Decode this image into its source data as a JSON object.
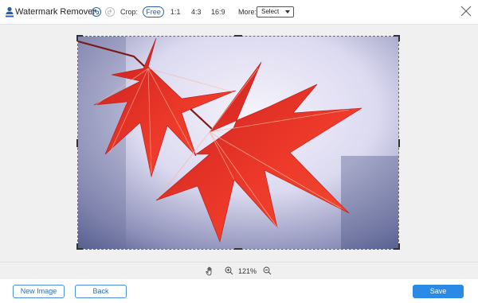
{
  "app": {
    "title": "Watermark Remover",
    "logo_icon": "person-upload-icon"
  },
  "toolbar": {
    "undo_icon": "undo-icon",
    "redo_icon": "redo-icon",
    "crop_label": "Crop:",
    "crop_options": [
      "Free",
      "1:1",
      "4:3",
      "16:9"
    ],
    "crop_selected": "Free",
    "more_label": "More:",
    "more_select_value": "Select",
    "close_icon": "close-icon"
  },
  "zoom": {
    "hand_icon": "hand-pan-icon",
    "zoom_in_icon": "zoom-in-icon",
    "level": "121%",
    "zoom_out_icon": "zoom-out-icon"
  },
  "footer": {
    "new_image_label": "New Image",
    "back_label": "Back",
    "save_label": "Save"
  },
  "colors": {
    "accent": "#2b8ae6",
    "accent_dark": "#2a5fa8",
    "leaf_red": "#e8362a",
    "background_gray": "#f0f0f0"
  }
}
